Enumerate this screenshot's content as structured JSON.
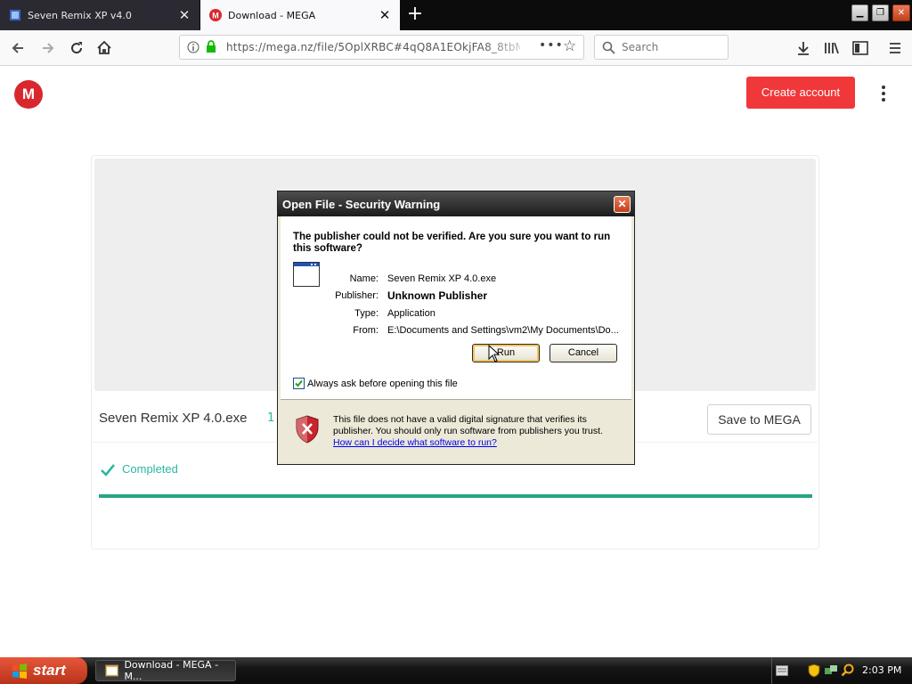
{
  "browser": {
    "tabs": [
      {
        "title": "Seven Remix XP v4.0",
        "active": false
      },
      {
        "title": "Download - MEGA",
        "active": true
      }
    ],
    "url": "https://mega.nz/file/5OplXRBC#4qQ8A1EOkjFA8_8tbM",
    "search_placeholder": "Search"
  },
  "page": {
    "logo": "M",
    "create_account": "Create account",
    "file_name": "Seven Remix XP 4.0.exe",
    "file_size_partial": "1",
    "save_button": "Save to MEGA",
    "status": "Completed",
    "progress": 1.0,
    "accent": "#2bb7a3",
    "brand": "#d9272e"
  },
  "dialog": {
    "title": "Open File - Security Warning",
    "question": "The publisher could not be verified.  Are you sure you want to run this software?",
    "fields": [
      {
        "label": "Name:",
        "value": "Seven Remix XP 4.0.exe"
      },
      {
        "label": "Publisher:",
        "value": "Unknown Publisher"
      },
      {
        "label": "Type:",
        "value": "Application"
      },
      {
        "label": "From:",
        "value": "E:\\Documents and Settings\\vm2\\My Documents\\Do..."
      }
    ],
    "run": "Run",
    "cancel": "Cancel",
    "checkbox_label": "Always ask before opening this file",
    "checkbox_checked": true,
    "footer_text": "This file does not have a valid digital signature that verifies its publisher.  You should only run software from publishers you trust.",
    "footer_link": "How can I decide what software to run?"
  },
  "taskbar": {
    "start": "start",
    "task": "Download - MEGA - M...",
    "clock": "2:03 PM"
  }
}
